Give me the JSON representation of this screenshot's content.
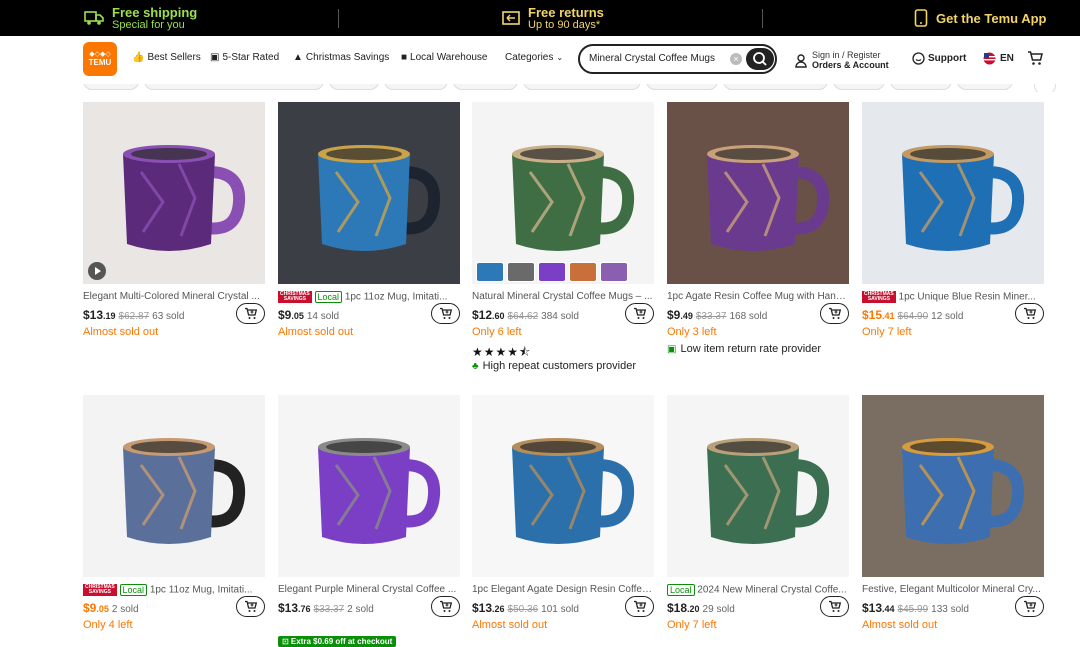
{
  "promo": {
    "shipping_title": "Free shipping",
    "shipping_sub": "Special for you",
    "returns_title": "Free returns",
    "returns_sub": "Up to 90 days*",
    "app_label": "Get the Temu App"
  },
  "header": {
    "logo_text": "TEMU",
    "nav": [
      {
        "label": "Best Sellers",
        "icon": "thumbs-up-icon"
      },
      {
        "label": "5-Star Rated",
        "icon": "star-badge-icon"
      },
      {
        "label": "Christmas Savings",
        "icon": "tree-icon"
      },
      {
        "label": "Local Warehouse",
        "icon": "truck-icon"
      },
      {
        "label": "Categories",
        "icon": "chevron-down-icon"
      }
    ],
    "search_value": "Mineral Crystal Coffee Mugs",
    "account_line1": "Sign in / Register",
    "account_line2": "Orders & Account",
    "support_label": "Support",
    "lang_label": "EN"
  },
  "badges": {
    "christmas": "CHRISTMAS SAVINGS",
    "local": "Local"
  },
  "products": [
    {
      "title": "Elegant Multi-Colored Mineral Crystal ...",
      "price_main": "$13",
      "price_cents": ".19",
      "old_price": "$62.87",
      "sold": "63 sold",
      "urgency": "Almost sold out",
      "xmas": false,
      "local": false,
      "price_orange": false
    },
    {
      "title": "1pc 11oz Mug, Imitati...",
      "price_main": "$9",
      "price_cents": ".05",
      "old_price": "",
      "sold": "14 sold",
      "urgency": "Almost sold out",
      "xmas": true,
      "local": true,
      "price_orange": false
    },
    {
      "title": "Natural Mineral Crystal Coffee Mugs – ...",
      "price_main": "$12",
      "price_cents": ".60",
      "old_price": "$64.62",
      "sold": "384 sold",
      "urgency": "Only 6 left",
      "xmas": false,
      "local": false,
      "price_orange": false,
      "stars": "★★★★⯪",
      "note": "High repeat customers provider"
    },
    {
      "title": "1pc Agate Resin Coffee Mug with Hand...",
      "price_main": "$9",
      "price_cents": ".49",
      "old_price": "$33.37",
      "sold": "168 sold",
      "urgency": "Only 3 left",
      "xmas": false,
      "local": false,
      "price_orange": false,
      "note": "Low item return rate provider"
    },
    {
      "title": "1pc Unique Blue Resin Miner...",
      "price_main": "$15",
      "price_cents": ".41",
      "old_price": "$64.90",
      "sold": "12 sold",
      "urgency": "Only 7 left",
      "xmas": true,
      "local": false,
      "price_orange": true
    },
    {
      "title": "1pc 11oz Mug, Imitati...",
      "price_main": "$9",
      "price_cents": ".05",
      "old_price": "",
      "sold": "2 sold",
      "urgency": "Only 4 left",
      "xmas": true,
      "local": true,
      "price_orange": true
    },
    {
      "title": "Elegant Purple Mineral Crystal Coffee ...",
      "price_main": "$13",
      "price_cents": ".76",
      "old_price": "$33.37",
      "sold": "2 sold",
      "urgency": "",
      "xmas": false,
      "local": false,
      "price_orange": false,
      "coupon": "Extra $0.69 off at checkout"
    },
    {
      "title": "1pc Elegant Agate Design Resin Coffee ...",
      "price_main": "$13",
      "price_cents": ".26",
      "old_price": "$50.36",
      "sold": "101 sold",
      "urgency": "Almost sold out",
      "xmas": false,
      "local": false,
      "price_orange": false
    },
    {
      "title": "2024 New Mineral Crystal Coffe...",
      "price_main": "$18",
      "price_cents": ".20",
      "old_price": "",
      "sold": "29 sold",
      "urgency": "Only 7 left",
      "xmas": false,
      "local": true,
      "price_orange": false
    },
    {
      "title": "Festive, Elegant Multicolor Mineral Cry...",
      "price_main": "$13",
      "price_cents": ".44",
      "old_price": "$45.99",
      "sold": "133 sold",
      "urgency": "Almost sold out",
      "xmas": false,
      "local": false,
      "price_orange": false
    }
  ],
  "colors": {
    "accent": "#fb7701",
    "promo_green": "#9be04e",
    "promo_yellow": "#f2d46b",
    "local_green": "#0a8f08",
    "xmas_red": "#c8102e"
  }
}
